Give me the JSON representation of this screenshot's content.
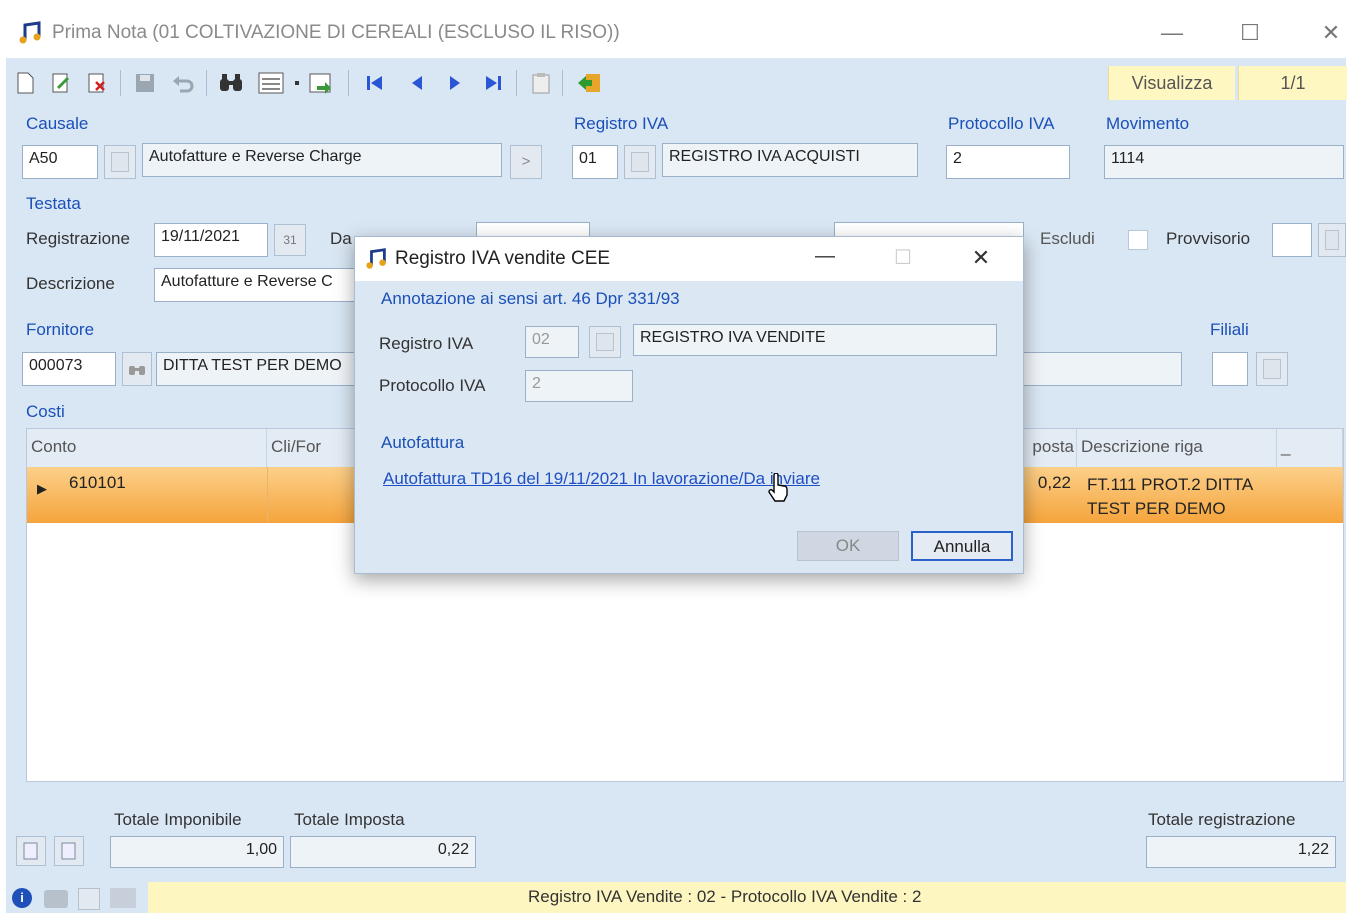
{
  "window": {
    "title": "Prima Nota (01 COLTIVAZIONE DI CEREALI (ESCLUSO IL RISO))",
    "minimize": "—",
    "maximize": "☐",
    "close": "✕"
  },
  "toolbar": {
    "visualizza_label": "Visualizza",
    "record_position": "1/1",
    "icons": [
      "new-icon",
      "edit-icon",
      "delete-icon",
      "save-icon",
      "undo-icon",
      "search-binoculars-icon",
      "list-view-icon",
      "dropdown-icon",
      "export-icon",
      "first-record-icon",
      "prev-record-icon",
      "next-record-icon",
      "last-record-icon",
      "notes-icon",
      "exit-icon"
    ]
  },
  "form": {
    "causale_label": "Causale",
    "causale_code": "A50",
    "causale_desc": "Autofatture e Reverse Charge",
    "causale_go": ">",
    "registro_iva_label": "Registro IVA",
    "registro_iva_code": "01",
    "registro_iva_desc": "REGISTRO IVA ACQUISTI",
    "protocollo_iva_label": "Protocollo IVA",
    "protocollo_iva_value": "2",
    "movimento_label": "Movimento",
    "movimento_value": "1114",
    "testata_label": "Testata",
    "registrazione_label": "Registrazione",
    "registrazione_value": "19/11/2021",
    "calendar_text": "31",
    "data_doc_label_partial": "Da",
    "escludi_label": "Escludi",
    "provvisorio_label": "Provvisorio",
    "descrizione_label": "Descrizione",
    "descrizione_value": "Autofatture e Reverse C",
    "fornitore_label": "Fornitore",
    "fornitore_code": "000073",
    "fornitore_name": "DITTA TEST PER DEMO",
    "filiali_label": "Filiali",
    "costi_label": "Costi"
  },
  "grid": {
    "headers": {
      "conto": "Conto",
      "clifor": "Cli/For",
      "imposta_partial": "posta",
      "descrizione_riga": "Descrizione riga",
      "more": "_"
    },
    "rows": [
      {
        "indicator": "▶",
        "conto": "610101",
        "imposta": "0,22",
        "descrizione_riga": "FT.111 PROT.2 DITTA TEST PER DEMO"
      }
    ]
  },
  "totals": {
    "imponibile_label": "Totale Imponibile",
    "imponibile_value": "1,00",
    "imposta_label": "Totale Imposta",
    "imposta_value": "0,22",
    "registrazione_label": "Totale registrazione",
    "registrazione_value": "1,22"
  },
  "status": {
    "message": "Registro IVA Vendite : 02 - Protocollo IVA Vendite : 2"
  },
  "dialog": {
    "title": "Registro IVA vendite CEE",
    "minimize": "—",
    "maximize": "☐",
    "close": "✕",
    "annotation": "Annotazione ai sensi art. 46 Dpr 331/93",
    "registro_iva_label": "Registro IVA",
    "registro_iva_code": "02",
    "registro_iva_desc": "REGISTRO IVA VENDITE",
    "protocollo_iva_label": "Protocollo IVA",
    "protocollo_iva_value": "2",
    "autofattura_label": "Autofattura",
    "autofattura_link": "Autofattura TD16 del 19/11/2021 In lavorazione/Da inviare",
    "ok_label": "OK",
    "annulla_label": "Annulla"
  },
  "colors": {
    "form_bg": "#d9e6f3",
    "label_blue": "#1a50b8",
    "row_highlight": "#f5a43c",
    "status_yellow": "#fdf6c0"
  }
}
